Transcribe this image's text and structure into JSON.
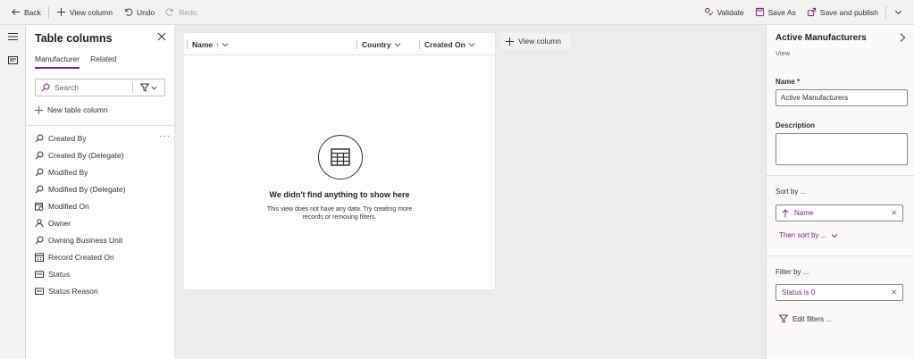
{
  "toolbar": {
    "back": "Back",
    "view_column": "View column",
    "undo": "Undo",
    "redo": "Redo",
    "validate": "Validate",
    "save_as": "Save As",
    "save_publish": "Save and publish"
  },
  "left_panel": {
    "title": "Table columns",
    "tabs": [
      "Manufacturer",
      "Related"
    ],
    "search_placeholder": "Search",
    "new_column": "New table column",
    "columns": [
      {
        "label": "Created By",
        "icon": "lookup-icon"
      },
      {
        "label": "Created By (Delegate)",
        "icon": "lookup-icon"
      },
      {
        "label": "Modified By",
        "icon": "lookup-icon"
      },
      {
        "label": "Modified By (Delegate)",
        "icon": "lookup-icon"
      },
      {
        "label": "Modified On",
        "icon": "datetime-icon"
      },
      {
        "label": "Owner",
        "icon": "person-icon"
      },
      {
        "label": "Owning Business Unit",
        "icon": "lookup-icon"
      },
      {
        "label": "Record Created On",
        "icon": "calendar-icon"
      },
      {
        "label": "Status",
        "icon": "choice-icon"
      },
      {
        "label": "Status Reason",
        "icon": "choice-icon"
      }
    ]
  },
  "grid": {
    "columns": [
      {
        "label": "Name",
        "sort": "↑"
      },
      {
        "label": "Country"
      },
      {
        "label": "Created On"
      }
    ],
    "add_column": "View column",
    "empty_title": "We didn't find anything to show here",
    "empty_desc": "This view does not have any data. Try creating more records or removing filters."
  },
  "right_panel": {
    "title": "Active Manufacturers",
    "subtitle": "View",
    "name_label": "Name *",
    "name_value": "Active Manufacturers",
    "description_label": "Description",
    "description_value": "",
    "sort_label": "Sort by ...",
    "sort_chip": "Name",
    "then_sort": "Then sort by ...",
    "filter_label": "Filter by ...",
    "filter_chip": "Status is 0",
    "edit_filters": "Edit filters ..."
  },
  "colors": {
    "accent": "#742774",
    "border": "#e1dfdd",
    "canvas": "#edebe9"
  }
}
